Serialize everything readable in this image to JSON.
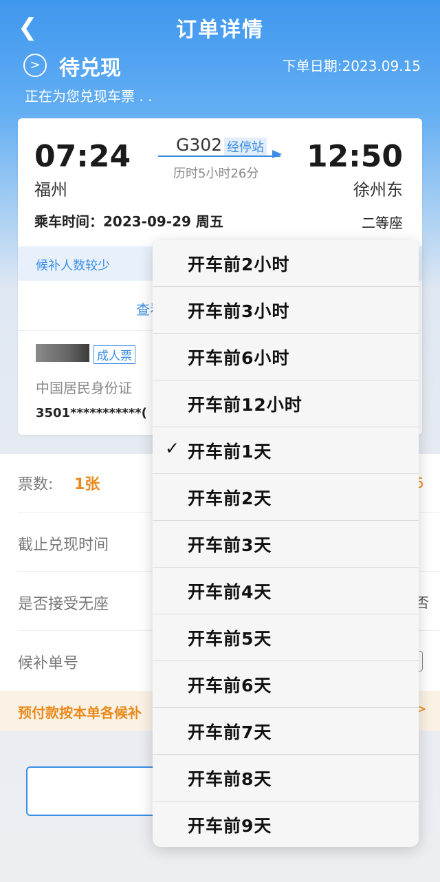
{
  "header": {
    "back_icon": "chevron-left-icon",
    "title": "订单详情"
  },
  "status": {
    "icon": "circle-arrow-icon",
    "title": "待兑现",
    "order_date": "下单日期:2023.09.15",
    "subtitle": "正在为您兑现车票 . ."
  },
  "trip": {
    "train_no": "G302",
    "stops_link": "经停站",
    "departure_time": "07:24",
    "departure_station": "福州",
    "arrival_time": "12:50",
    "arrival_station": "徐州东",
    "duration": "历时5小时26分",
    "ride_date": "乘车时间：2023-09-29 周五",
    "seat_class": "二等座",
    "waitlist_note": "候补人数较少",
    "view_link": "查看"
  },
  "passenger": {
    "ticket_type": "成人票",
    "id_type": "中国居民身份证",
    "id_number": "3501***********("
  },
  "details": {
    "count_label": "票数:",
    "count_value": "1张",
    "deadline_label": "截止兑现时间",
    "standing_label": "是否接受无座",
    "order_no_label": "候补单号",
    "edge_orange": "5",
    "edge_text": "否",
    "notice": "预付款按本单各候补",
    "notice_chevron": ">"
  },
  "dropdown": {
    "selected_index": 4,
    "check_icon": "checkmark-icon",
    "check_glyph": "✓",
    "options": [
      "开车前2小时",
      "开车前3小时",
      "开车前6小时",
      "开车前12小时",
      "开车前1天",
      "开车前2天",
      "开车前3天",
      "开车前4天",
      "开车前5天",
      "开车前6天",
      "开车前7天",
      "开车前8天",
      "开车前9天"
    ]
  }
}
